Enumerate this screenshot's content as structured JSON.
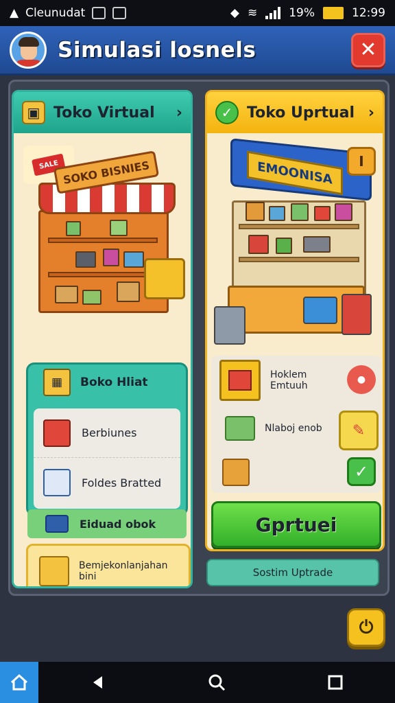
{
  "status_bar": {
    "carrier": "Cleunudat",
    "battery_percent": "19%",
    "time": "12:99"
  },
  "header": {
    "title": "Simulasi losnels"
  },
  "left_panel": {
    "tab_label": "Toko Virtual",
    "badge_text": "SALE",
    "sign_text": "SOKO BISNIES",
    "list_header": "Boko Hliat",
    "items": [
      {
        "label": "Berbiunes"
      },
      {
        "label": "Foldes Bratted"
      }
    ],
    "stock_label": "Eiduad obok",
    "info_text": "Bemjekonlanjahan bini"
  },
  "right_panel": {
    "tab_label": "Toko Uprtual",
    "badge_text": "I",
    "sign_text": "EMOONISA",
    "rows": [
      {
        "label": "Hoklem\nEmtuuh"
      },
      {
        "label": "Nlaboj enob"
      },
      {
        "label": ""
      }
    ],
    "action_button": "Gprtuei",
    "system_button": "Sostim Uptrade"
  },
  "colors": {
    "header_blue": "#2f62b8",
    "teal": "#2fb59f",
    "yellow": "#f4b30f",
    "green": "#33b02a",
    "red": "#e23a2e"
  }
}
